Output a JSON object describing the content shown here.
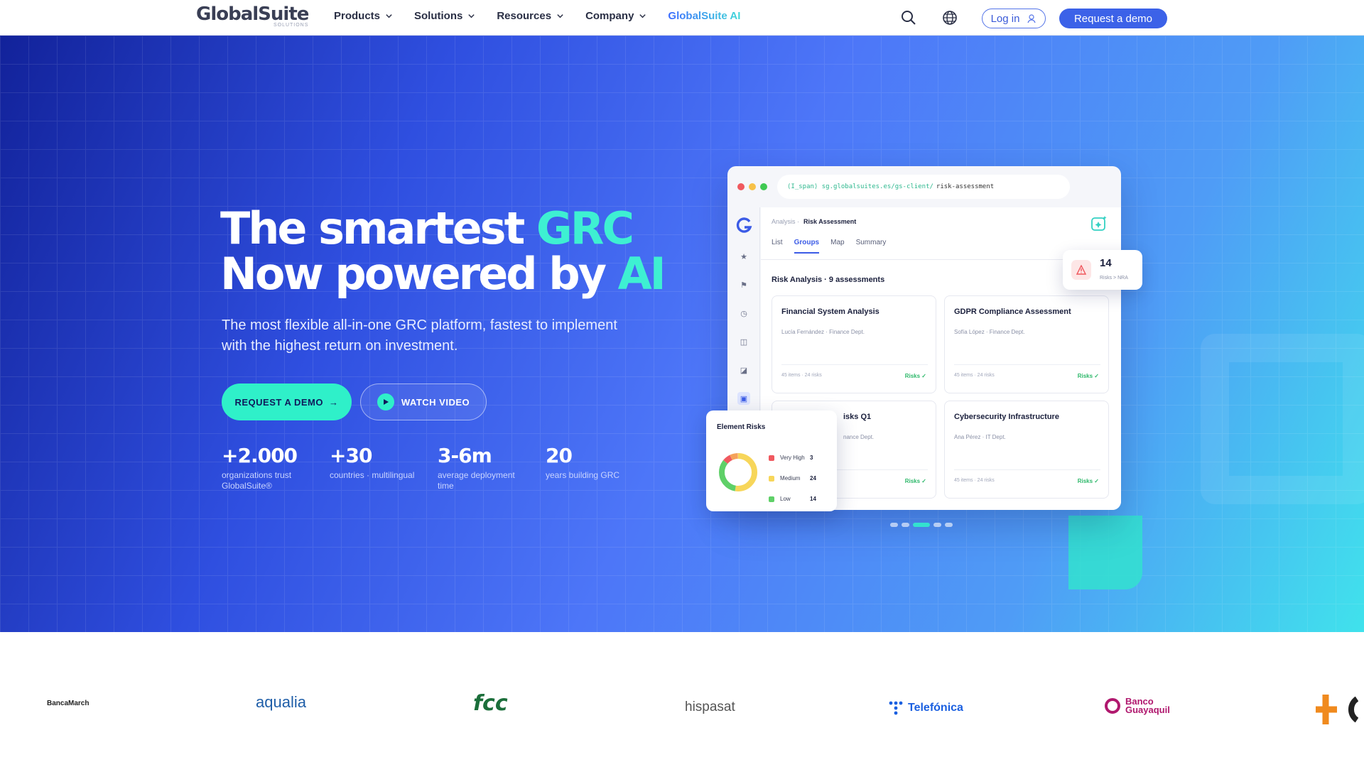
{
  "header": {
    "logo": "GlobalSuite",
    "logo_sub": "SOLUTIONS",
    "nav": [
      "Products",
      "Solutions",
      "Resources",
      "Company"
    ],
    "nav_ai": "GlobalSuite AI",
    "login": "Log in",
    "demo": "Request a demo"
  },
  "hero": {
    "title_line1": "The smartest ",
    "title_accent1": "GRC",
    "title_line2": "Now powered by ",
    "title_accent2": "AI",
    "subtitle": "The most flexible all-in-one GRC platform, fastest to implement with the highest return on investment.",
    "cta_primary": "REQUEST A DEMO",
    "cta_arrow": "→",
    "cta_video": "WATCH VIDEO",
    "stats": [
      {
        "value": "+2.000",
        "label": "organizations trust GlobalSuite®"
      },
      {
        "value": "+30",
        "label": "countries · multilingual"
      },
      {
        "value": "3-6m",
        "label": "average deployment time"
      },
      {
        "value": "20",
        "label": "years building GRC"
      }
    ]
  },
  "mockup": {
    "url_prefix": "⟨I̲span⟩ sg.globalsuites.es/gs-client/",
    "url_path": "risk-assessment",
    "breadcrumb_parent": "Analysis ·",
    "breadcrumb_current": "Risk Assessment",
    "tabs": [
      "List",
      "Groups",
      "Map",
      "Summary"
    ],
    "section_title": "Risk Analysis · 9 assessments",
    "cards": [
      {
        "title": "Financial System Analysis",
        "owner": "Lucía Fernández · Finance Dept.",
        "meta": "45 items · 24 risks",
        "risk": "Risks ✓"
      },
      {
        "title": "GDPR Compliance Assessment",
        "owner": "Sofía López · Finance Dept.",
        "meta": "45 items · 24 risks",
        "risk": "Risks ✓"
      },
      {
        "title": "isks Q1",
        "owner": "nance Dept.",
        "meta": "",
        "risk": "Risks ✓"
      },
      {
        "title": "Cybersecurity Infrastructure",
        "owner": "Ana Pérez · IT Dept.",
        "meta": "45 items · 24 risks",
        "risk": "Risks ✓"
      }
    ],
    "float_stat": {
      "value": "14",
      "label": "Risks > NRA"
    },
    "element_risks": {
      "title": "Element Risks",
      "items": [
        {
          "name": "Very High",
          "value": "3",
          "color": "#f0595f"
        },
        {
          "name": "Medium",
          "value": "24",
          "color": "#f7d65a"
        },
        {
          "name": "Low",
          "value": "14",
          "color": "#5fd068"
        }
      ]
    }
  },
  "logos": {
    "banca": "BancaMarch",
    "aqualia": "aqualia",
    "fcc": "fcc",
    "hispasat": "hispasat",
    "telefonica": "Telefónica",
    "banco_line1": "Banco",
    "banco_line2": "Guayaquil"
  },
  "colors": {
    "accent_teal": "#2ff0c9",
    "brand_blue": "#3c62e8"
  }
}
